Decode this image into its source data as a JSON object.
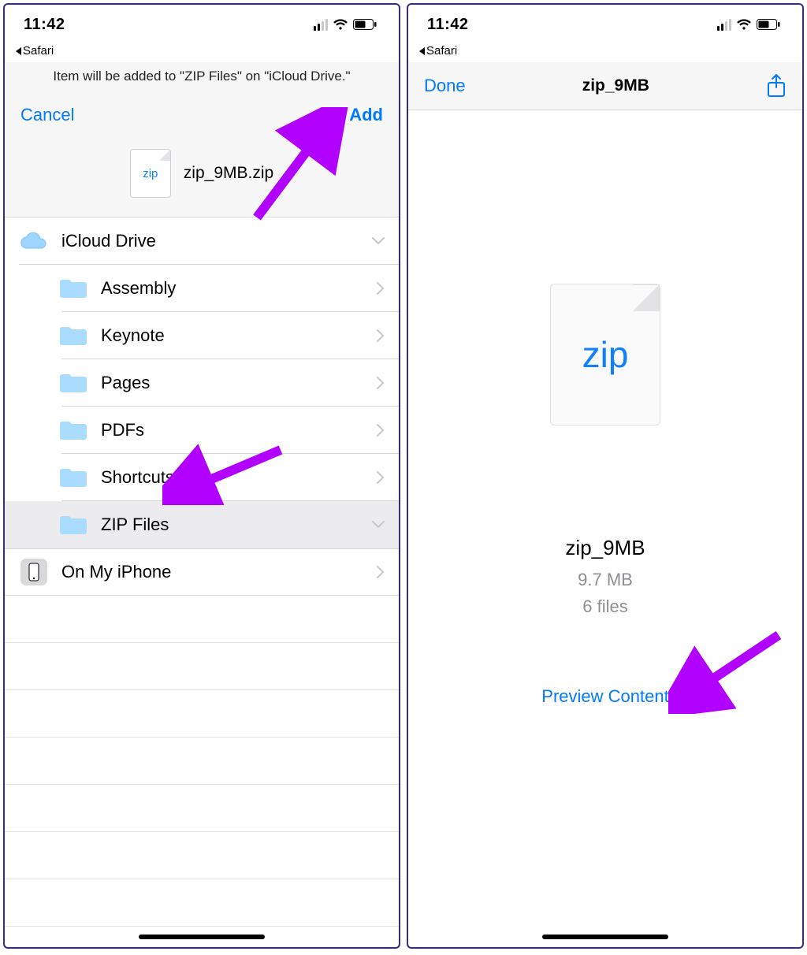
{
  "status": {
    "time": "11:42",
    "back_app": "Safari"
  },
  "left": {
    "subtitle": "Item will be added to \"ZIP Files\" on \"iCloud Drive.\"",
    "cancel": "Cancel",
    "add": "Add",
    "file_thumb_label": "zip",
    "file_name": "zip_9MB.zip",
    "roots": {
      "icloud": "iCloud Drive",
      "on_my_iphone": "On My iPhone"
    },
    "folders": [
      {
        "label": "Assembly"
      },
      {
        "label": "Keynote"
      },
      {
        "label": "Pages"
      },
      {
        "label": "PDFs"
      },
      {
        "label": "Shortcuts"
      },
      {
        "label": "ZIP Files",
        "selected": true
      }
    ]
  },
  "right": {
    "done": "Done",
    "title": "zip_9MB",
    "big_thumb_label": "zip",
    "filename": "zip_9MB",
    "size": "9.7 MB",
    "count": "6 files",
    "preview": "Preview Content"
  }
}
